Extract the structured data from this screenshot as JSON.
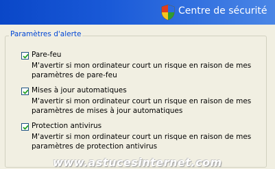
{
  "header": {
    "title": "Centre de sécurité",
    "icon": "shield-icon"
  },
  "alerts": {
    "group_title": "Paramètres d'alerte",
    "options": [
      {
        "label": "Pare-feu",
        "checked": true,
        "description": "M'avertir si mon ordinateur court un risque en raison de mes paramètres de pare-feu"
      },
      {
        "label": "Mises à jour automatiques",
        "checked": true,
        "description": "M'avertir si mon ordinateur court un risque en raison de mes paramètres de mises à jour automatiques"
      },
      {
        "label": "Protection antivirus",
        "checked": true,
        "description": "M'avertir si mon ordinateur court un risque en raison de mes paramètres de protection antivirus"
      }
    ]
  },
  "watermark": "www.astucesinternet.com",
  "colors": {
    "header_start": "#0a47c8",
    "header_end": "#4a86e6",
    "group_title": "#0046d5",
    "background": "#f1efe2"
  }
}
